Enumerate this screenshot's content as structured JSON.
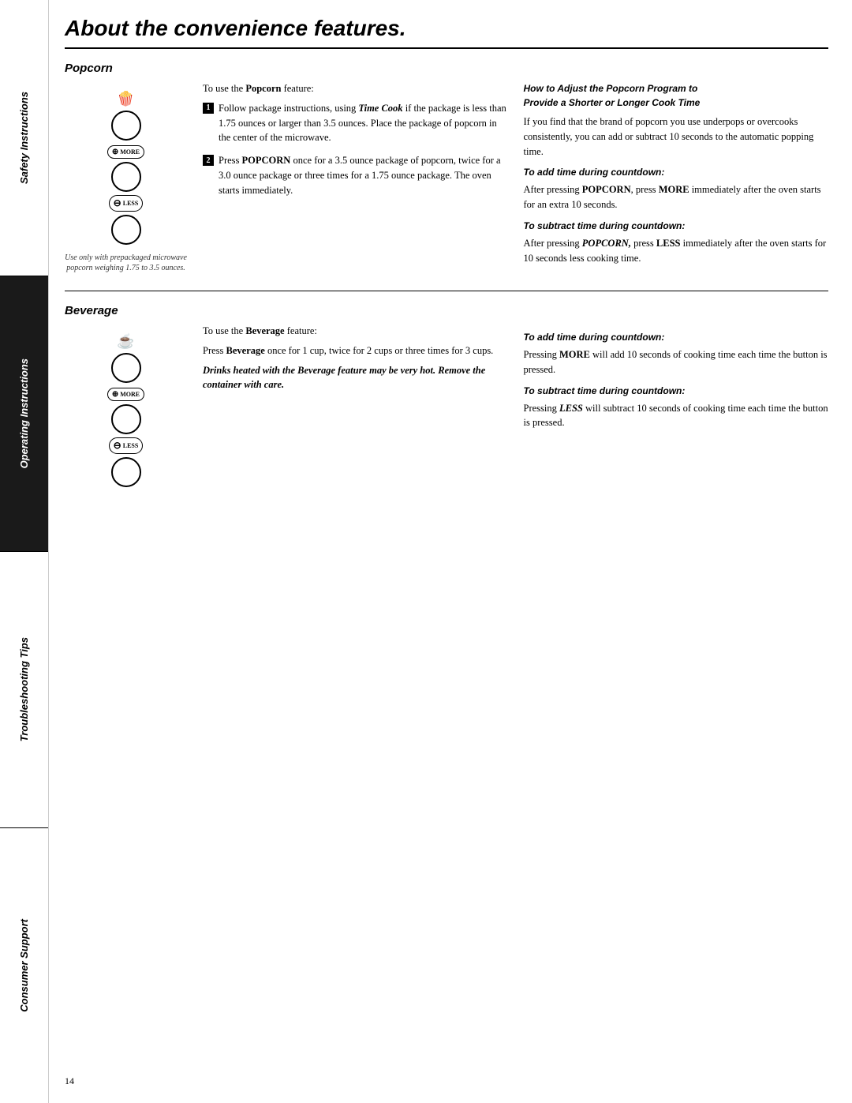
{
  "sidebar": {
    "sections": [
      {
        "label": "Safety Instructions",
        "dark": false
      },
      {
        "label": "Operating Instructions",
        "dark": true
      },
      {
        "label": "Troubleshooting Tips",
        "dark": false
      },
      {
        "label": "Consumer Support",
        "dark": false
      }
    ]
  },
  "page": {
    "title": "About the convenience features.",
    "number": "14"
  },
  "popcorn": {
    "heading": "Popcorn",
    "illustration_note": "Use only with prepackaged microwave popcorn weighing 1.75 to 3.5 ounces.",
    "intro": "To use the Popcorn feature:",
    "step1": "Follow package instructions, using Time Cook if the package is less than 1.75 ounces or larger than 3.5 ounces. Place the package of popcorn in the center of the microwave.",
    "step2": "Press POPCORN once for a 3.5 ounce package of popcorn, twice for a 3.0 ounce package or three times for a 1.75 ounce package. The oven starts immediately.",
    "adjust_heading1": "How to Adjust the Popcorn Program to",
    "adjust_heading2": "Provide a Shorter or Longer Cook Time",
    "adjust_intro": "If you find that the brand of popcorn you use underpops or overcooks consistently, you can add or subtract 10 seconds to the automatic popping time.",
    "add_time_heading": "To add time during countdown:",
    "add_time_text": "After pressing POPCORN, press MORE immediately after the oven starts for an extra 10 seconds.",
    "subtract_time_heading": "To subtract time during countdown:",
    "subtract_time_text": "After pressing POPCORN, press LESS immediately after the oven starts for 10 seconds less cooking time."
  },
  "beverage": {
    "heading": "Beverage",
    "intro": "To use the Beverage feature:",
    "usage": "Press Beverage once for 1 cup, twice for 2 cups or three times for 3 cups.",
    "warning": "Drinks heated with the Beverage feature may be very hot. Remove the container with care.",
    "add_time_heading": "To add time during countdown:",
    "add_time_text": "Pressing MORE will add 10 seconds of cooking time each time the button is pressed.",
    "subtract_time_heading": "To subtract time during countdown:",
    "subtract_time_text": "Pressing LESS will subtract 10 seconds of cooking time each time the button is pressed."
  }
}
